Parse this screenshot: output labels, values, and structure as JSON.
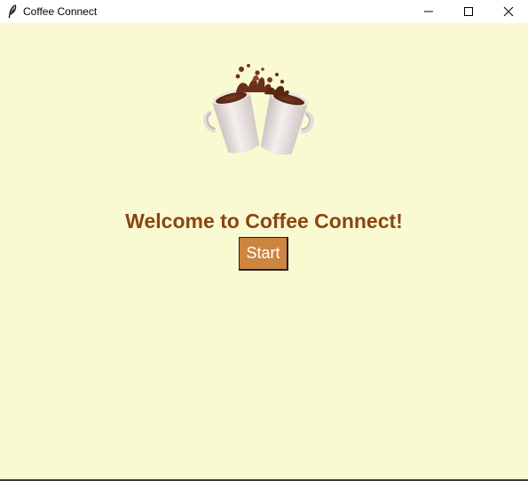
{
  "window": {
    "title": "Coffee Connect",
    "icon": "feather-icon",
    "controls": {
      "minimize": "minimize-icon",
      "maximize": "maximize-icon",
      "close": "close-icon"
    }
  },
  "main": {
    "image": "coffee-mugs-cheers-icon",
    "welcome_text": "Welcome to Coffee Connect!",
    "start_label": "Start"
  },
  "colors": {
    "background": "#fafad2",
    "welcome_text": "#8b4513",
    "start_button": "#cd853f",
    "start_button_text": "#ffffff"
  }
}
